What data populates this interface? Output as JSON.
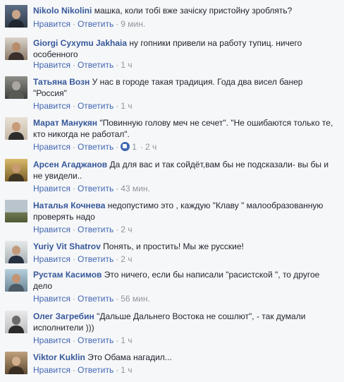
{
  "actions": {
    "like": "Нравится",
    "reply": "Ответить",
    "separator": "·"
  },
  "comments": [
    {
      "author": "Nikolo Nikolini",
      "text": "машка, коли тобі вже зачіску пристойну зроблять?",
      "time": "9 мин.",
      "reactions": ""
    },
    {
      "author": "Giorgi Сухуmu Jakhaia",
      "text": "ну гопники привели на работу тупиц. ничего особенного",
      "time": "1 ч",
      "reactions": ""
    },
    {
      "author": "Татьяна Возн",
      "text": "У нас в городе такая традиция. Года два висел банер \"Россия\"",
      "time": "1 ч",
      "reactions": ""
    },
    {
      "author": "Марат Манукян",
      "text": "\"Повинную голову меч не сечет\". \"Не ошибаются только те, кто никогда не работал\".",
      "time": "2 ч",
      "reactions": "1"
    },
    {
      "author": "Арсен Агаджанов",
      "text": "Да для вас и так сойдёт,вам бы не подсказали- вы бы и не увидели..",
      "time": "43 мин.",
      "reactions": ""
    },
    {
      "author": "Наталья Кочнева",
      "text": "недопустимо это , каждую \"Клаву \" малообразованную проверять надо",
      "time": "2 ч",
      "reactions": ""
    },
    {
      "author": "Yuriy Vit Shatrov",
      "text": "Понять, и простить! Мы же русские!",
      "time": "2 ч",
      "reactions": ""
    },
    {
      "author": "Рустам Касимов",
      "text": "Это ничего, если бы написали \"расистской \", то другое дело",
      "time": "56 мин.",
      "reactions": ""
    },
    {
      "author": "Олег Загребин",
      "text": "\"Дальше Дальнего Востока не сошлют\", - так думали исполнители )))",
      "time": "1 ч",
      "reactions": ""
    },
    {
      "author": "Viktor Kuklin",
      "text": "Это Обама нагадил...",
      "time": "1 ч",
      "reactions": ""
    }
  ],
  "colors": {
    "link": "#4267b2",
    "author": "#365899",
    "meta": "#90949c",
    "text": "#1d2129",
    "background": "#f6f7f9"
  }
}
